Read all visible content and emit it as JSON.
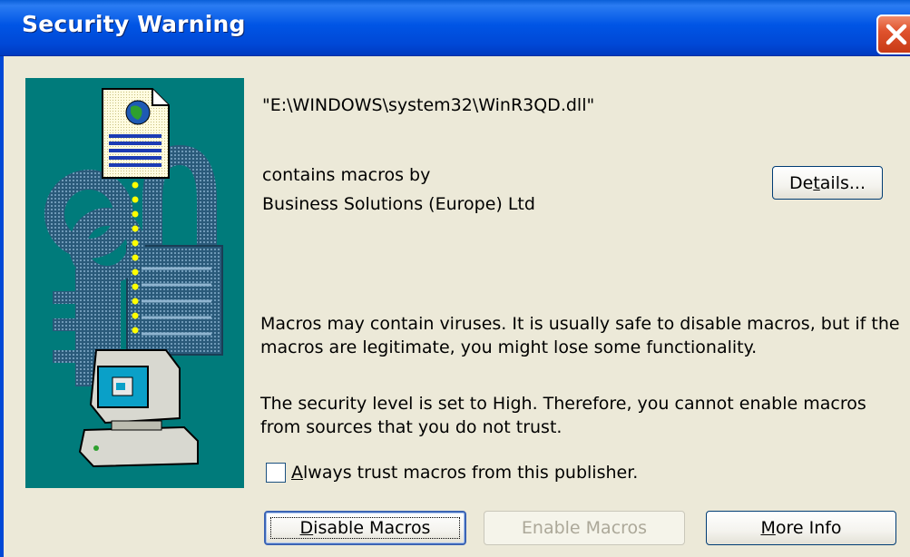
{
  "window": {
    "title": "Security Warning"
  },
  "file_path": "\"E:\\WINDOWS\\system32\\WinR3QD.dll\"",
  "macros_by_line1": "contains macros by",
  "publisher": "Business Solutions (Europe) Ltd",
  "details_button": {
    "label": "Details...",
    "accelerator": "t"
  },
  "warning_text": {
    "line1": "Macros may contain viruses. It is usually safe to disable macros, but if the",
    "line2": "macros are legitimate, you might lose some functionality."
  },
  "security_text": {
    "line1": "The security level is set to High.  Therefore, you cannot enable macros",
    "line2": "from sources that you do not trust."
  },
  "trust_checkbox": {
    "label": "Always trust macros from this publisher.",
    "checked": false
  },
  "buttons": {
    "disable": "Disable Macros",
    "enable": "Enable Macros",
    "more_info": "More Info"
  },
  "colors": {
    "titlebar": "#0055e5",
    "dialog_bg": "#ece9d8",
    "illustration_bg": "#007b7b",
    "close_button": "#e0532e"
  },
  "icons": [
    "close-icon",
    "document-globe-icon",
    "padlock-keys-icon",
    "computer-icon"
  ]
}
